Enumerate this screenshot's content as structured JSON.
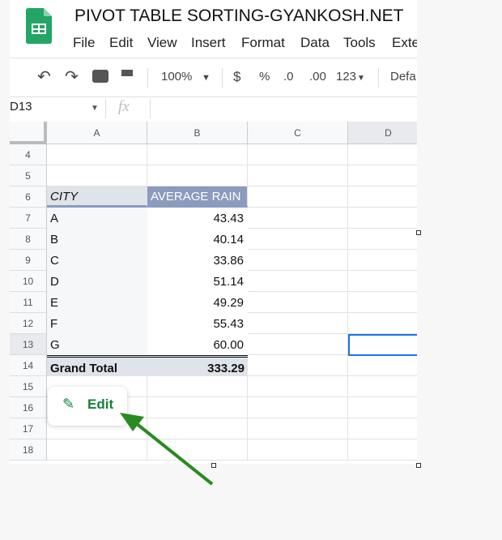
{
  "doc_title": "PIVOT TABLE SORTING-GYANKOSH.NET",
  "menu": [
    "File",
    "Edit",
    "View",
    "Insert",
    "Format",
    "Data",
    "Tools",
    "Exte"
  ],
  "toolbar": {
    "zoom": "100%",
    "currency": "$",
    "percent": "%",
    "dec_less": ".0",
    "dec_more": ".00",
    "format_more": "123",
    "font": "Defa"
  },
  "name_box": "D13",
  "fx": "fx",
  "columns": [
    "A",
    "B",
    "C",
    "D"
  ],
  "rows": [
    "4",
    "5",
    "6",
    "7",
    "8",
    "9",
    "10",
    "11",
    "12",
    "13",
    "14",
    "15",
    "16",
    "17",
    "18"
  ],
  "pivot": {
    "header": [
      "CITY",
      "AVERAGE RAIN"
    ],
    "data": [
      [
        "A",
        "43.43"
      ],
      [
        "B",
        "40.14"
      ],
      [
        "C",
        "33.86"
      ],
      [
        "D",
        "51.14"
      ],
      [
        "E",
        "49.29"
      ],
      [
        "F",
        "55.43"
      ],
      [
        "G",
        "60.00"
      ]
    ],
    "total": [
      "Grand Total",
      "333.29"
    ]
  },
  "edit_button": "Edit",
  "colors": {
    "sheets_green": "#23a566",
    "header_blue": "#8a9bbd",
    "header_gray": "#dfe3ea",
    "edit_green": "#188038",
    "arrow_green": "#2a8a1f",
    "selection": "#1a73e8"
  }
}
